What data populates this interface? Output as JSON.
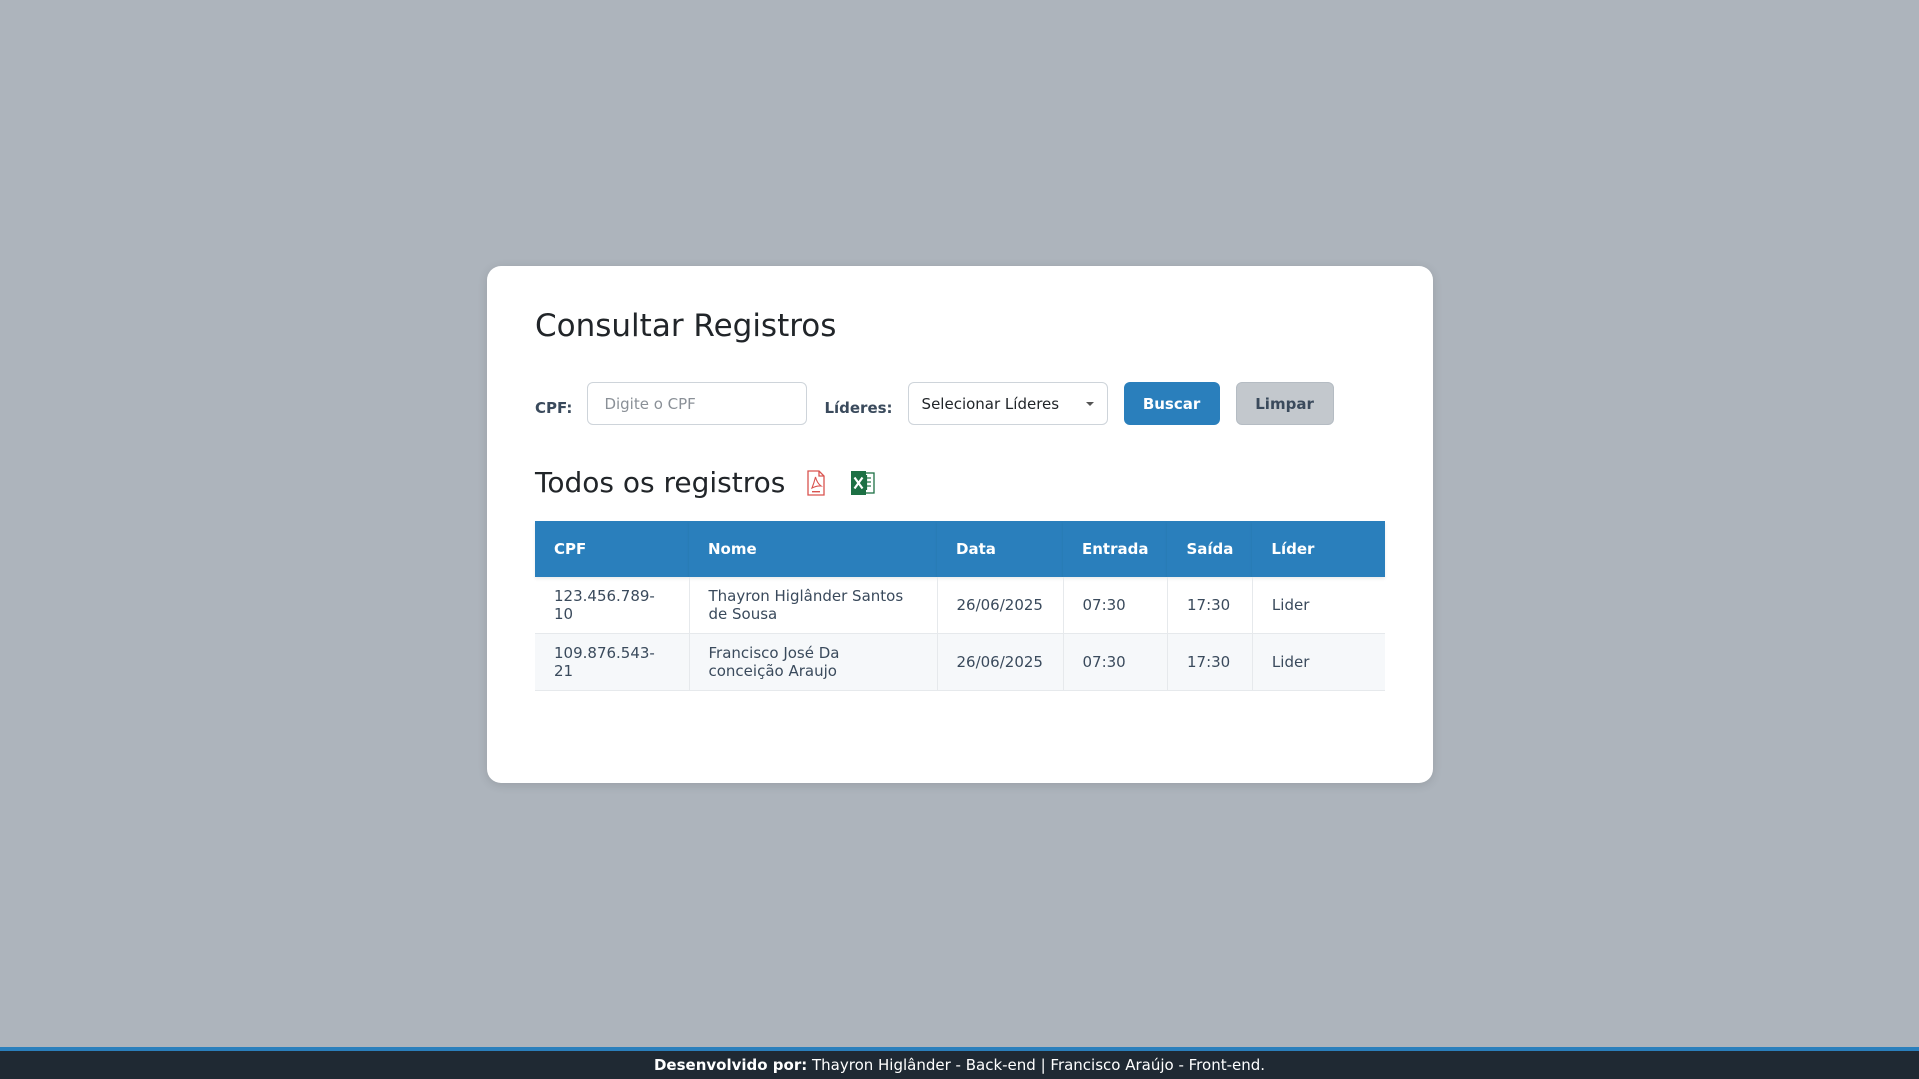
{
  "page": {
    "title": "Consultar Registros"
  },
  "filters": {
    "cpf_label": "CPF:",
    "cpf_placeholder": "Digite o CPF",
    "cpf_value": "",
    "leaders_label": "Líderes:",
    "leaders_selected": "Selecionar Líderes",
    "search_label": "Buscar",
    "clear_label": "Limpar"
  },
  "records": {
    "title": "Todos os registros",
    "export_icons": [
      "pdf-icon",
      "excel-icon"
    ],
    "columns": [
      "CPF",
      "Nome",
      "Data",
      "Entrada",
      "Saída",
      "Líder"
    ],
    "rows": [
      [
        "123.456.789-10",
        "Thayron Higlânder Santos de Sousa",
        "26/06/2025",
        "07:30",
        "17:30",
        "Lider"
      ],
      [
        "109.876.543-21",
        "Francisco José Da conceição Araujo",
        "26/06/2025",
        "07:30",
        "17:30",
        "Lider"
      ]
    ]
  },
  "footer": {
    "prefix": "Desenvolvido por:",
    "text": " Thayron Higlânder - Back-end | Francisco Araújo - Front-end."
  },
  "colors": {
    "primary": "#2a7fbc",
    "background": "#adb4bc",
    "footer": "#1f2933"
  }
}
